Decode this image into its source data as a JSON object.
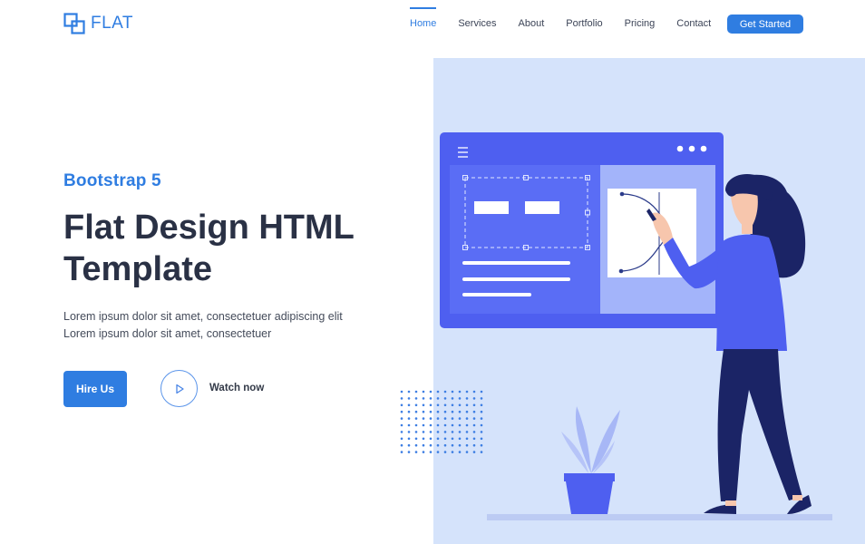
{
  "brand": {
    "name": "FLAT"
  },
  "nav": {
    "items": [
      {
        "label": "Home",
        "active": true
      },
      {
        "label": "Services",
        "active": false
      },
      {
        "label": "About",
        "active": false
      },
      {
        "label": "Portfolio",
        "active": false
      },
      {
        "label": "Pricing",
        "active": false
      },
      {
        "label": "Contact",
        "active": false
      }
    ],
    "cta_label": "Get Started"
  },
  "hero": {
    "eyebrow": "Bootstrap 5",
    "title_line1": "Flat Design HTML",
    "title_line2": "Template",
    "lead_line1": "Lorem ipsum dolor sit amet, consectetuer adipiscing elit",
    "lead_line2": "Lorem ipsum dolor sit amet, consectetuer",
    "primary_button": "Hire Us",
    "secondary_button": "Watch now"
  },
  "icons": {
    "logo": "overlapping-squares-icon",
    "play": "play-icon",
    "menu": "hamburger-icon"
  },
  "colors": {
    "accent": "#2f7de1",
    "heading": "#2a3145",
    "illustration_bg": "#d5e3fb",
    "panel": "#4e5ff0",
    "figure_dark": "#1b2466"
  }
}
